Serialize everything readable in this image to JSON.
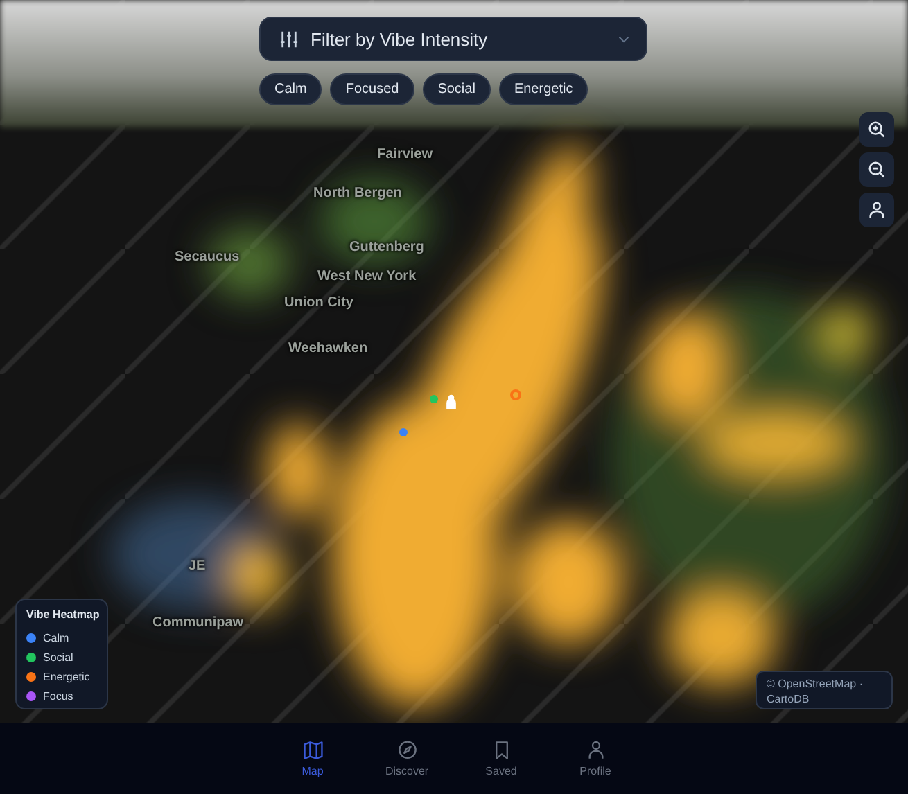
{
  "filter": {
    "label": "Filter by Vibe Intensity"
  },
  "chips": [
    {
      "label": "Calm",
      "selected": false
    },
    {
      "label": "Focused",
      "selected": false
    },
    {
      "label": "Social",
      "selected": false
    },
    {
      "label": "Energetic",
      "selected": false
    }
  ],
  "map": {
    "place_labels": [
      "Fairview",
      "North Bergen",
      "Secaucus",
      "Guttenberg",
      "West New York",
      "Union City",
      "Weehawken",
      "JE",
      "Communipaw"
    ],
    "markers": [
      {
        "color": "#22c55e"
      },
      {
        "color": "#3b82f6"
      },
      {
        "color": "#f97316"
      }
    ],
    "attribution": "© OpenStreetMap · CartoDB"
  },
  "legend": {
    "title": "Vibe Heatmap",
    "items": [
      {
        "label": "Calm",
        "color": "#3b82f6"
      },
      {
        "label": "Social",
        "color": "#22c55e"
      },
      {
        "label": "Energetic",
        "color": "#f97316"
      },
      {
        "label": "Focus",
        "color": "#a855f7"
      }
    ]
  },
  "nav": [
    {
      "kind": "map",
      "label": "Map",
      "selected": true
    },
    {
      "kind": "discover",
      "label": "Discover",
      "selected": false
    },
    {
      "kind": "saved",
      "label": "Saved",
      "selected": false
    },
    {
      "kind": "profile",
      "label": "Profile",
      "selected": false
    }
  ]
}
